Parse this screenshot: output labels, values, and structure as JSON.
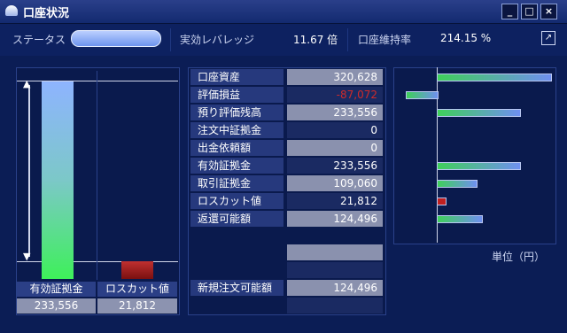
{
  "window": {
    "title": "口座状況",
    "minimize": "_",
    "maximize": "□",
    "close": "×"
  },
  "status": {
    "status_label": "ステータス",
    "leverage_label": "実効レバレッジ",
    "leverage_value": "11.67 倍",
    "maintenance_label": "口座維持率",
    "maintenance_value": "214.15 %",
    "status_level": 1.0
  },
  "left_chart": {
    "bars": [
      {
        "label": "有効証拠金",
        "value": "233,556"
      },
      {
        "label": "ロスカット値",
        "value": "21,812"
      }
    ]
  },
  "table": {
    "rows": [
      {
        "label": "口座資産",
        "value": "320,628"
      },
      {
        "label": "評価損益",
        "value": "-87,072"
      },
      {
        "label": "預り評価残高",
        "value": "233,556"
      },
      {
        "label": "注文中証拠金",
        "value": "0"
      },
      {
        "label": "出金依頼額",
        "value": "0"
      },
      {
        "label": "有効証拠金",
        "value": "233,556"
      },
      {
        "label": "取引証拠金",
        "value": "109,060"
      },
      {
        "label": "ロスカット値",
        "value": "21,812"
      },
      {
        "label": "返還可能額",
        "value": "124,496"
      }
    ],
    "new_order_label": "新規注文可能額",
    "new_order_value": "124,496"
  },
  "right_chart": {
    "unit": "単位（円）",
    "values": [
      320628,
      -87072,
      233556,
      0,
      0,
      233556,
      109060,
      21812,
      124496
    ],
    "colors": {
      "asset": "#3fd05a",
      "loss": "#5577dd",
      "small": "#c02020"
    }
  }
}
